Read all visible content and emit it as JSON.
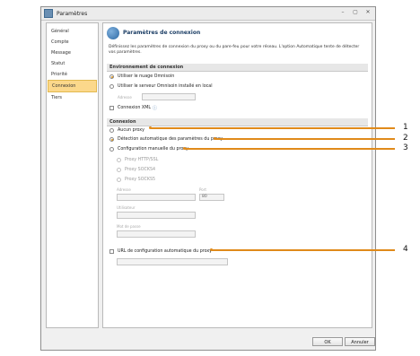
{
  "window": {
    "title": "Paramètres",
    "controls": [
      "–",
      "▢",
      "✕"
    ]
  },
  "sidebar": {
    "items": [
      {
        "label": "Général",
        "active": false
      },
      {
        "label": "Compte",
        "active": false
      },
      {
        "label": "Message",
        "active": false
      },
      {
        "label": "Statut",
        "active": false
      },
      {
        "label": "Priorité",
        "active": false
      },
      {
        "label": "Connexion",
        "active": true
      },
      {
        "label": "Tiers",
        "active": false
      }
    ]
  },
  "panel": {
    "title": "Paramètres de connexion",
    "description": "Définissez les paramètres de connexion du proxy ou du pare-feu pour votre réseau. L'option Automatique tente de détecter vos paramètres.",
    "env_section": "Environnement de connexion",
    "env_options": {
      "cloud": "Utiliser le nuage Omnisoin",
      "local": "Utiliser le serveur Omnisoin installé en local",
      "address_label": "Adresse",
      "xml": "Connexion XML"
    },
    "conn_section": "Connexion",
    "conn_options": {
      "none": "Aucun proxy",
      "auto": "Détection automatique des paramètres du proxy",
      "manual": "Configuration manuelle du proxy",
      "http": "Proxy HTTP/SSL",
      "socks4": "Proxy SOCKS4",
      "socks5": "Proxy SOCKS5",
      "address_label": "Adresse",
      "port_label": "Port",
      "port_value": "80",
      "user_label": "Utilisateur",
      "password_label": "Mot de passe",
      "pac": "URL de configuration automatique du proxy"
    }
  },
  "buttons": {
    "ok": "OK",
    "cancel": "Annuler"
  },
  "callouts": [
    "1",
    "2",
    "3",
    "4"
  ],
  "colors": {
    "accent": "#e08a1a",
    "active_item": "#fbd88b",
    "radio_selected": "#d38a13"
  }
}
